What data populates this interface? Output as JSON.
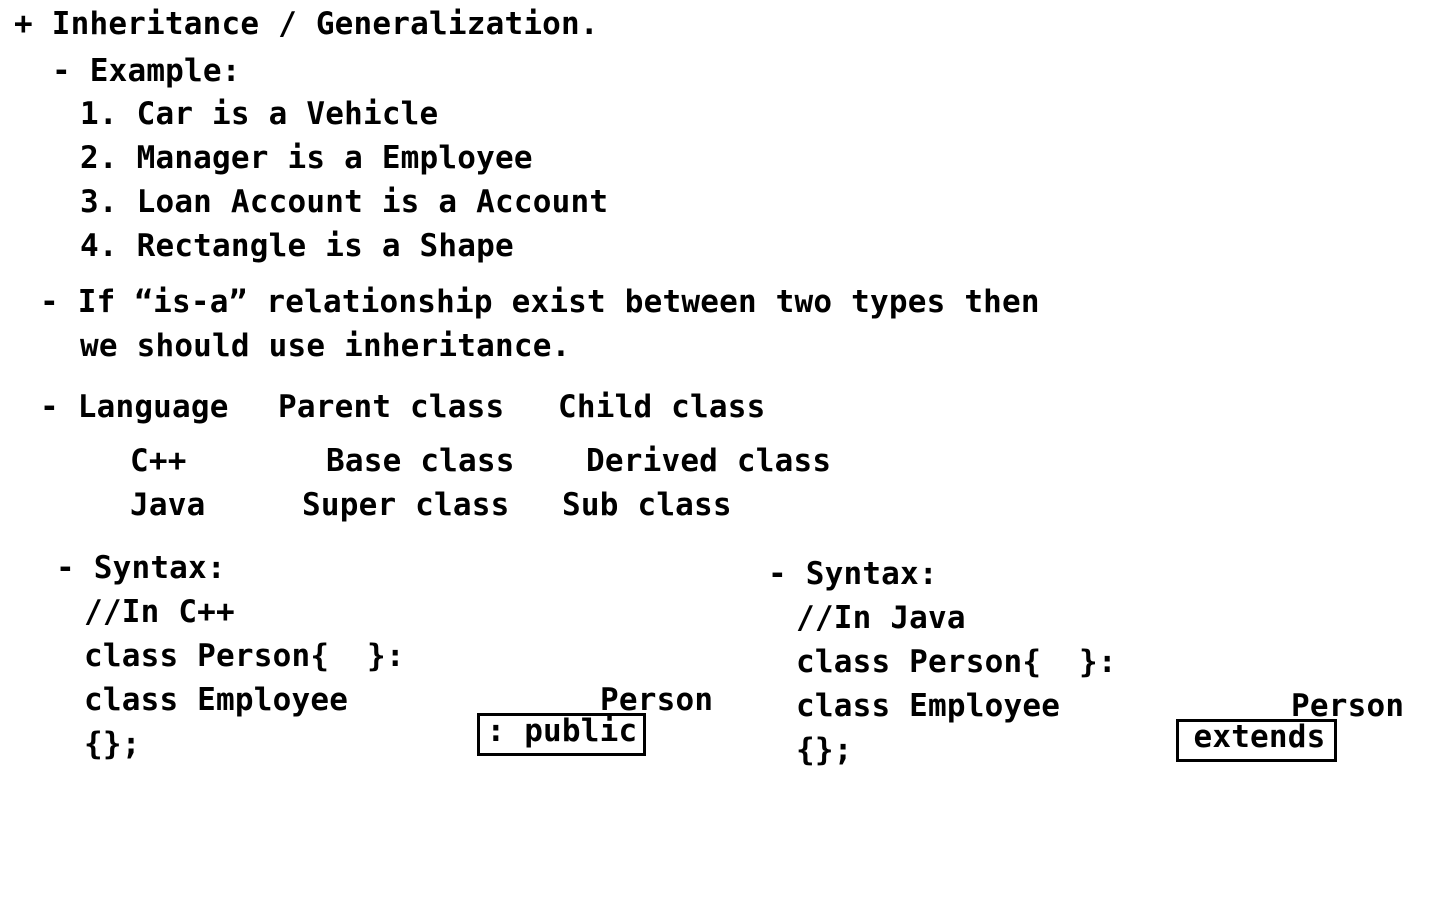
{
  "heading": "+ Inheritance / Generalization.",
  "example": {
    "label": "- Example:",
    "items": [
      "1. Car is a Vehicle",
      "2. Manager is a Employee",
      "3. Loan Account is a Account",
      "4. Rectangle is a Shape"
    ]
  },
  "rule": {
    "line1": "- If “is-a” relationship exist between two types then",
    "line2": "we should use inheritance."
  },
  "terminology": {
    "header": [
      "- Language",
      "Parent class",
      "Child class"
    ],
    "rows": [
      [
        "C++",
        "Base class",
        "Derived class"
      ],
      [
        "Java",
        "Super class",
        "Sub class"
      ]
    ]
  },
  "cpp_syntax": {
    "label": "- Syntax:",
    "comment": "//In C++",
    "line1": "class Person{  }:",
    "line2_prefix": "class Employee",
    "line2_keyword": ": public",
    "line2_suffix": "Person",
    "line3": "{};"
  },
  "java_syntax": {
    "label": "- Syntax:",
    "comment": "//In Java",
    "line1": "class Person{  }:",
    "line2_prefix": "class Employee",
    "line2_keyword": "extends",
    "line2_suffix": "Person",
    "line3": "{};"
  }
}
